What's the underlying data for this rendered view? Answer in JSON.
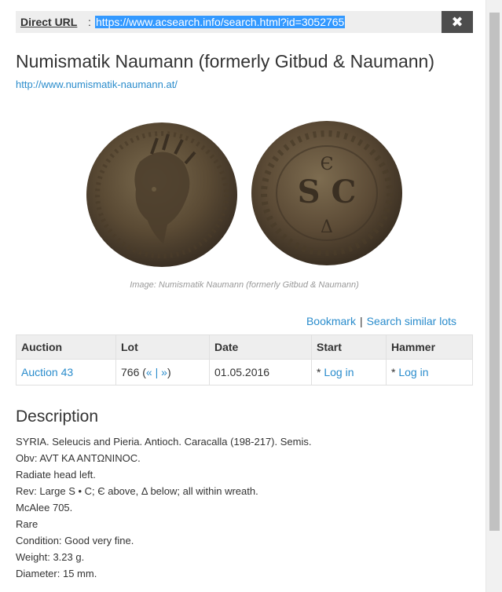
{
  "direct_url": {
    "label": "Direct URL",
    "colon": ":",
    "value": "https://www.acsearch.info/search.html?id=3052765"
  },
  "close_label": "✖",
  "auction_house": {
    "title": "Numismatik Naumann (formerly Gitbud & Naumann)",
    "website": "http://www.numismatik-naumann.at/"
  },
  "image": {
    "caption": "Image: Numismatik Naumann (formerly Gitbud & Naumann)",
    "reverse_letters": "S C"
  },
  "actions": {
    "bookmark": "Bookmark",
    "separator": "|",
    "similar": "Search similar lots"
  },
  "table": {
    "headers": [
      "Auction",
      "Lot",
      "Date",
      "Start",
      "Hammer"
    ],
    "row": {
      "auction": "Auction 43",
      "lot_number": "766 (",
      "lot_prev": "«",
      "lot_sep": " | ",
      "lot_next": "»",
      "lot_close": ")",
      "date": "01.05.2016",
      "start_prefix": "* ",
      "start_link": "Log in",
      "hammer_prefix": "* ",
      "hammer_link": "Log in"
    }
  },
  "description": {
    "heading": "Description",
    "lines": [
      "SYRIA. Seleucis and Pieria. Antioch. Caracalla (198-217). Semis.",
      "Obv: AVT KA ANTΩNINOC.",
      "Radiate head left.",
      "Rev: Large S • C; Є above, Δ below; all within wreath.",
      "McAlee 705.",
      "Rare",
      "Condition: Good very fine.",
      "Weight: 3.23 g.",
      "Diameter: 15 mm."
    ]
  },
  "colors": {
    "link": "#2a8ccc",
    "header_bg": "#eeeeee",
    "close_bg": "#4d4d4d",
    "selection": "#3399ff"
  }
}
